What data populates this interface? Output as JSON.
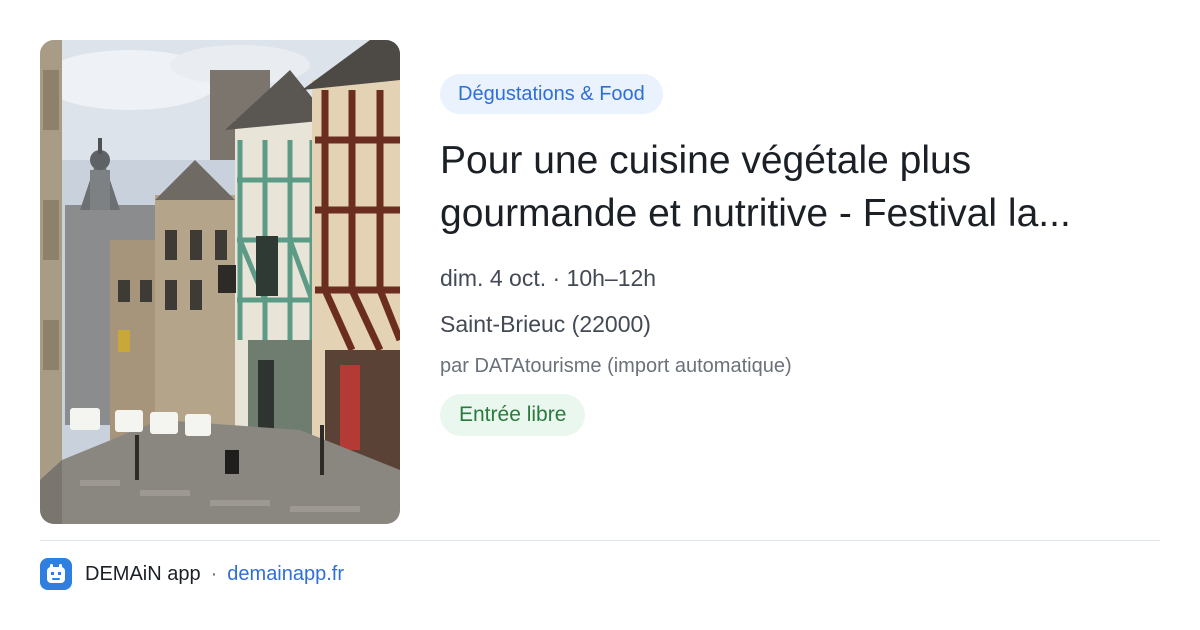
{
  "event": {
    "category": "Dégustations & Food",
    "title": "Pour une cuisine végétale plus gourmande et nutritive - Festival la...",
    "date_time": "dim. 4 oct. · 10h–12h",
    "location": "Saint-Brieuc (22000)",
    "source": "par DATAtourisme (import automatique)",
    "price": "Entrée libre",
    "photo_icon": "street-photo"
  },
  "footer": {
    "app_name": "DEMAiN app",
    "separator": "·",
    "domain": "demainapp.fr",
    "app_icon": "demain-logo-icon"
  },
  "colors": {
    "category_bg": "#eaf2fd",
    "category_text": "#2f6fd6",
    "price_bg": "#eaf7ee",
    "price_text": "#2a7a3e",
    "link": "#2f6fd6",
    "title": "#1b2027"
  }
}
